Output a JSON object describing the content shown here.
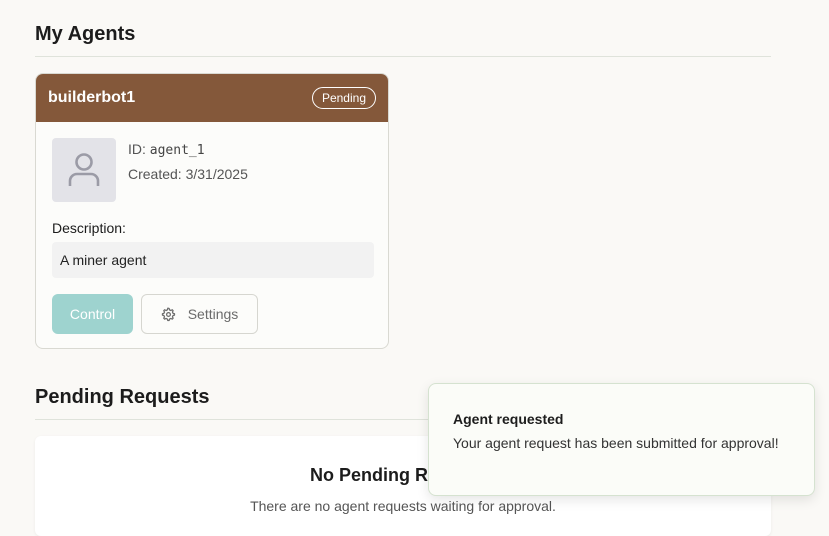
{
  "sections": {
    "my_agents_title": "My Agents",
    "pending_requests_title": "Pending Requests"
  },
  "agent_card": {
    "name": "builderbot1",
    "status": "Pending",
    "id_label": "ID:",
    "id_value": "agent_1",
    "created_label": "Created:",
    "created_value": "3/31/2025",
    "description_label": "Description:",
    "description_value": "A miner agent",
    "control_button": "Control",
    "settings_button": "Settings",
    "avatar_icon": "user-icon",
    "settings_icon": "gear-icon"
  },
  "pending": {
    "empty_title": "No Pending Requests",
    "empty_subtitle": "There are no agent requests waiting for approval."
  },
  "toast": {
    "title": "Agent requested",
    "message": "Your agent request has been submitted for approval!"
  },
  "colors": {
    "header_brown": "#84583a",
    "control_teal": "#9ed3cf",
    "page_background": "#faf9f6"
  }
}
